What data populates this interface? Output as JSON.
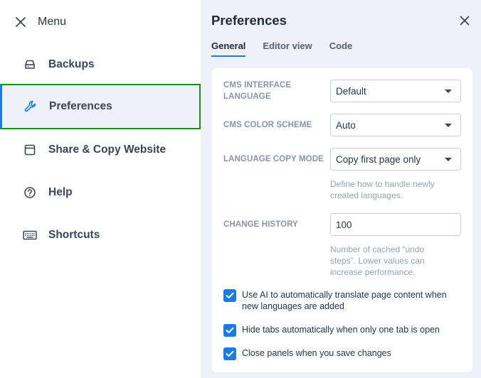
{
  "menu": {
    "title": "Menu",
    "items": [
      {
        "label": "Backups",
        "icon": "hard-drive-icon"
      },
      {
        "label": "Preferences",
        "icon": "wrench-icon"
      },
      {
        "label": "Share & Copy Website",
        "icon": "browser-window-icon"
      },
      {
        "label": "Help",
        "icon": "question-circle-icon"
      },
      {
        "label": "Shortcuts",
        "icon": "keyboard-icon"
      }
    ],
    "active_index": 1
  },
  "panel": {
    "title": "Preferences",
    "tabs": [
      {
        "label": "General",
        "active": true
      },
      {
        "label": "Editor view",
        "active": false
      },
      {
        "label": "Code",
        "active": false
      }
    ],
    "fields": {
      "cms_language": {
        "label": "CMS INTERFACE LANGUAGE",
        "value": "Default"
      },
      "color_scheme": {
        "label": "CMS COLOR SCHEME",
        "value": "Auto"
      },
      "copy_mode": {
        "label": "LANGUAGE COPY MODE",
        "value": "Copy first page only",
        "hint": "Define how to handle newly created languages."
      },
      "change_history": {
        "label": "CHANGE HISTORY",
        "value": "100",
        "hint": "Number of cached “undo steps”. Lower values can increase performance."
      }
    },
    "checkboxes": [
      {
        "label": "Use AI to automatically translate page content when new languages are added",
        "checked": true
      },
      {
        "label": "Hide tabs automatically when only one tab is open",
        "checked": true
      },
      {
        "label": "Close panels when you save changes",
        "checked": true
      }
    ]
  },
  "colors": {
    "accent": "#1c7be3",
    "panel_bg": "#eef1f7",
    "focus_outline": "#1e8a1e"
  }
}
